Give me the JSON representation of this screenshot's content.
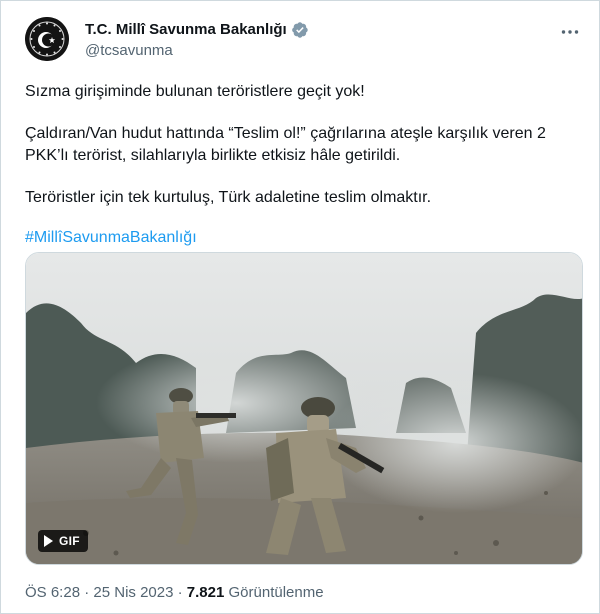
{
  "account": {
    "display_name": "T.C. Millî Savunma Bakanlığı",
    "handle": "@tcsavunma",
    "verified_icon": "verified-badge-icon",
    "colors": {
      "verified_gray": "#829aab"
    }
  },
  "more_icon": "more-options-icon",
  "tweet": {
    "line1": "Sızma girişiminde bulunan teröristlere geçit yok!",
    "line2": "Çaldıran/Van hudut hattında “Teslim ol!” çağrılarına ateşle karşılık veren 2 PKK’lı terörist, silahlarıyla birlikte etkisiz hâle getirildi.",
    "line3": "Teröristler için tek kurtuluş, Türk adaletine teslim olmaktır.",
    "hashtag": "#MillîSavunmaBakanlığı"
  },
  "media": {
    "badge_label": "GIF",
    "play_icon": "play-icon"
  },
  "meta": {
    "time": "ÖS 6:28",
    "separator": "·",
    "date": "25 Nis 2023",
    "views_count": "7.821",
    "views_label": "Görüntülenme"
  },
  "colors": {
    "text": "#0f1419",
    "secondary": "#536471",
    "link": "#1d9bf0",
    "border": "#cfd9de"
  }
}
